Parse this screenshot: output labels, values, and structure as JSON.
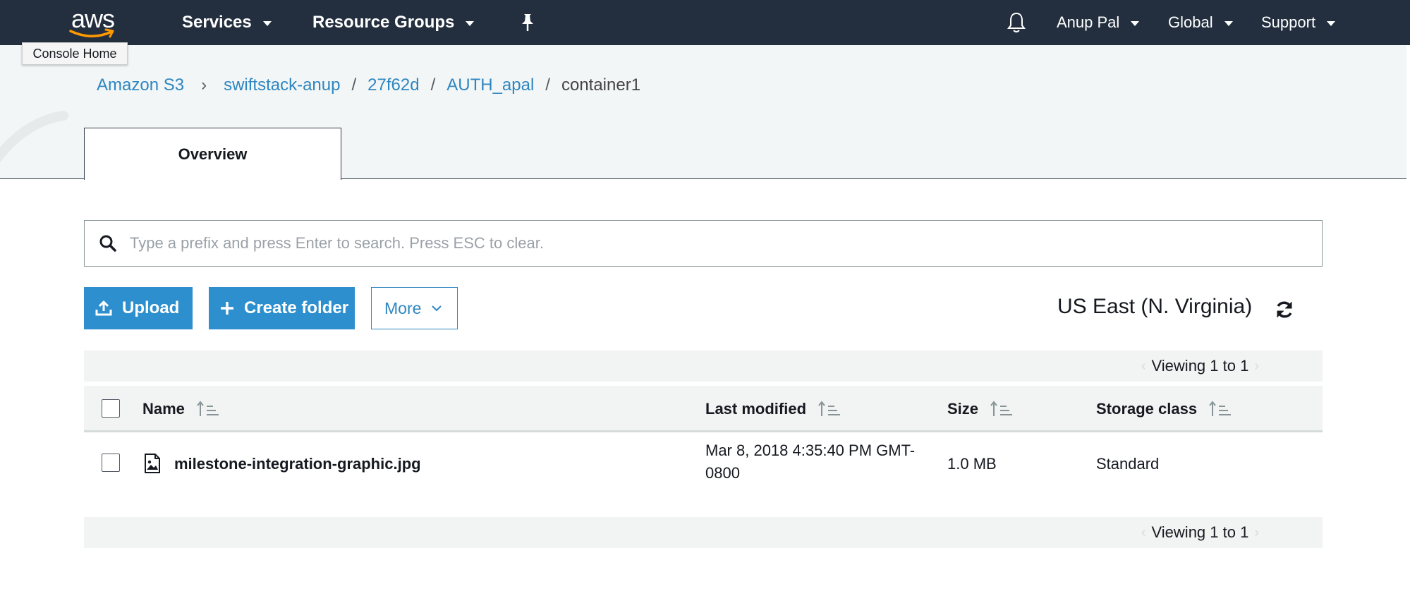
{
  "nav": {
    "logo_text": "aws",
    "services": "Services",
    "resource_groups": "Resource Groups",
    "user": "Anup Pal",
    "region_menu": "Global",
    "support": "Support"
  },
  "tooltip": "Console Home",
  "breadcrumb": [
    "Amazon S3",
    "swiftstack-anup",
    "27f62d",
    "AUTH_apal",
    "container1"
  ],
  "tab": "Overview",
  "search": {
    "placeholder": "Type a prefix and press Enter to search. Press ESC to clear."
  },
  "actions": {
    "upload": "Upload",
    "create_folder": "Create folder",
    "more": "More"
  },
  "region": "US East (N. Virginia)",
  "pager": "Viewing 1 to 1",
  "table": {
    "columns": [
      "Name",
      "Last modified",
      "Size",
      "Storage class"
    ],
    "rows": [
      {
        "name": "milestone-integration-graphic.jpg",
        "modified_line1": "Mar 8, 2018 4:35:40 PM GMT-",
        "modified_line2": "0800",
        "size": "1.0 MB",
        "storage_class": "Standard"
      }
    ]
  },
  "colors": {
    "nav_bg": "#232f3e",
    "primary": "#2e8fcf",
    "link": "#2e86c1"
  },
  "icons": [
    "pin-icon",
    "bell-icon",
    "search-icon",
    "upload-icon",
    "plus-icon",
    "chevron-down-icon",
    "refresh-icon",
    "sort-icon",
    "image-file-icon"
  ]
}
